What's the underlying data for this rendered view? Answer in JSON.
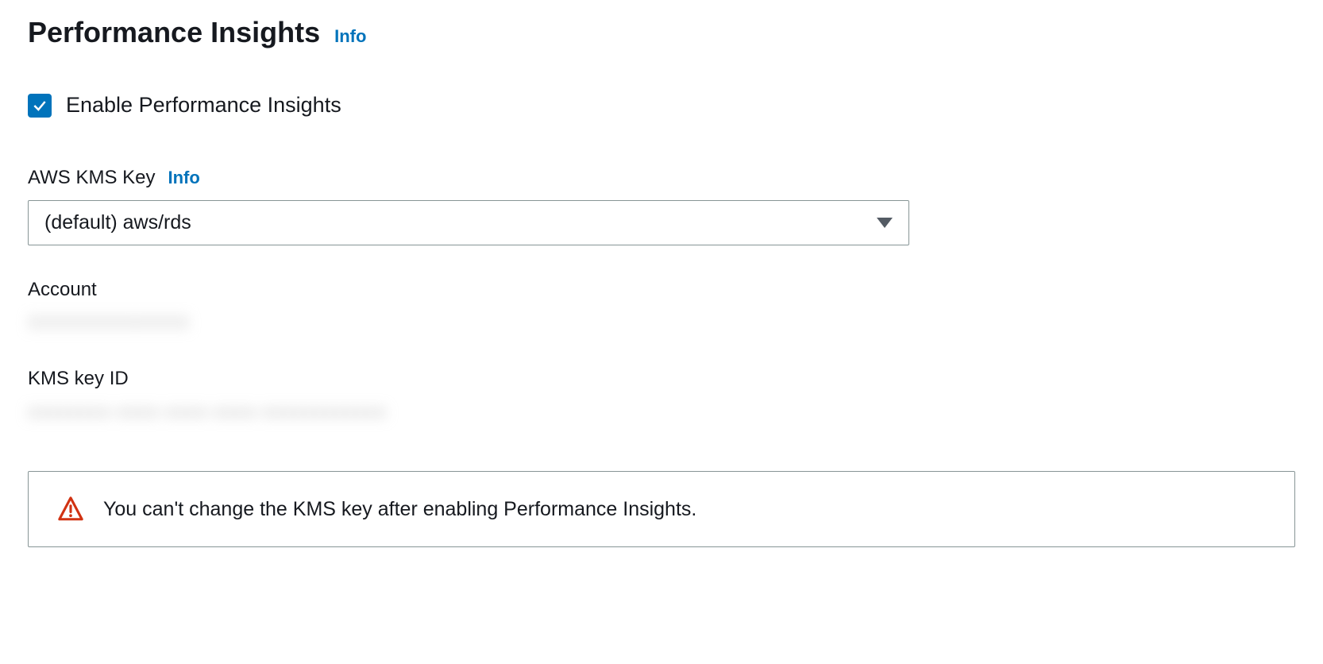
{
  "section": {
    "title": "Performance Insights",
    "info_link": "Info"
  },
  "enable_checkbox": {
    "checked": true,
    "label": "Enable Performance Insights"
  },
  "kms_key": {
    "label": "AWS KMS Key",
    "info_link": "Info",
    "selected_value": "(default) aws/rds"
  },
  "account": {
    "label": "Account",
    "value_redacted": "XXXXXXXXXXXX"
  },
  "kms_key_id": {
    "label": "KMS key ID",
    "value_redacted": "xxxxxxxx-xxxx-xxxx-xxxx-xxxxxxxxxxxx"
  },
  "alert": {
    "message": "You can't change the KMS key after enabling Performance Insights."
  }
}
